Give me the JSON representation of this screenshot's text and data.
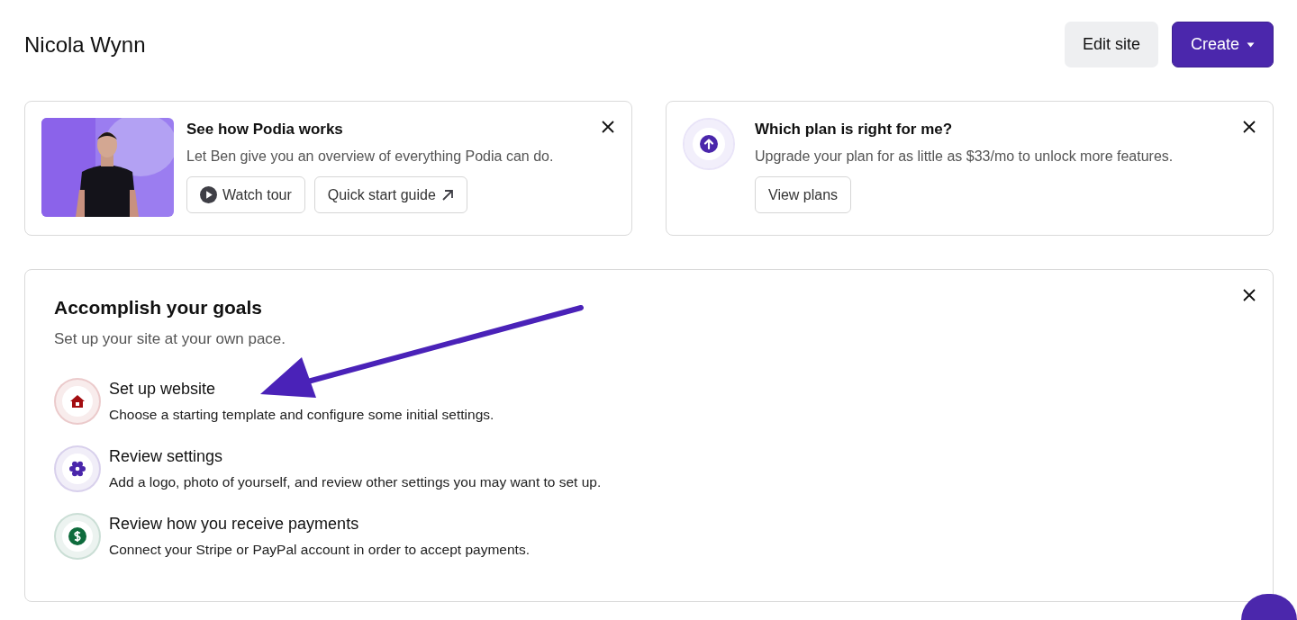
{
  "header": {
    "title": "Nicola Wynn",
    "buttons": [
      {
        "label": "Edit site",
        "kind": "secondary"
      },
      {
        "label": "Create",
        "kind": "primary"
      }
    ]
  },
  "cards": [
    {
      "kind": "video",
      "title": "See how Podia works",
      "text": "Let Ben give you an overview of everything Podia can do.",
      "buttons": [
        {
          "label": "Watch tour",
          "kind": "play"
        },
        {
          "label": "Quick start guide",
          "kind": "external"
        }
      ]
    },
    {
      "kind": "upgrade",
      "title": "Which plan is right for me?",
      "text": "Upgrade your plan for as little as $33/mo to unlock more features.",
      "buttons": [
        {
          "label": "View plans",
          "kind": "plain"
        }
      ]
    }
  ],
  "goals": {
    "title": "Accomplish your goals",
    "subtitle": "Set up your site at your own pace.",
    "items": [
      {
        "kind": "house",
        "color": "#a30d11",
        "title": "Set up website",
        "text": "Choose a starting template and configure some initial settings."
      },
      {
        "kind": "gear",
        "color": "#4a26ab",
        "title": "Review settings",
        "text": "Add a logo, photo of yourself, and review other settings you may want to set up."
      },
      {
        "kind": "dollar",
        "color": "#0e6b3c",
        "title": "Review how you receive payments",
        "text": "Connect your Stripe or PayPal account in order to accept payments."
      }
    ]
  }
}
